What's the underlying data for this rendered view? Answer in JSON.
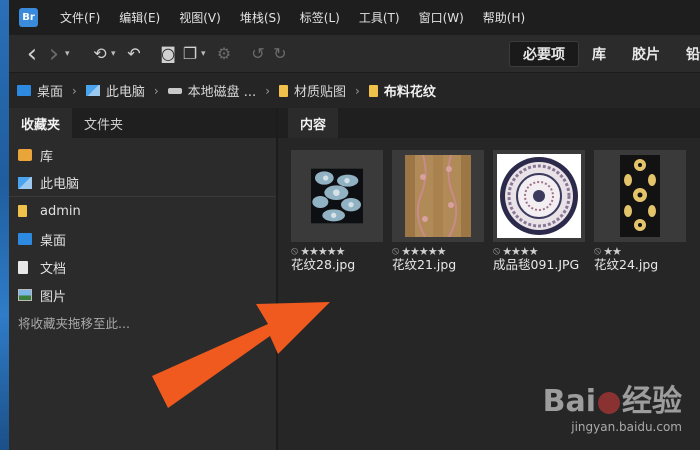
{
  "app": {
    "icon_text": "Br"
  },
  "menu": [
    {
      "label": "文件(F)"
    },
    {
      "label": "编辑(E)"
    },
    {
      "label": "视图(V)"
    },
    {
      "label": "堆栈(S)"
    },
    {
      "label": "标签(L)"
    },
    {
      "label": "工具(T)"
    },
    {
      "label": "窗口(W)"
    },
    {
      "label": "帮助(H)"
    }
  ],
  "toolbar": {
    "back_glyph": "‹",
    "forward_glyph": "›",
    "caret_glyph": "▾",
    "history_glyph": "⟲",
    "boomerang_glyph": "↶",
    "camera_glyph": "◙",
    "copy_glyph": "❐",
    "refine_glyph": "⚙",
    "rotate_left_glyph": "↺",
    "rotate_right_glyph": "↻",
    "workspaces": [
      {
        "label": "必要项",
        "active": true
      },
      {
        "label": "库"
      },
      {
        "label": "胶片"
      },
      {
        "label": "铅"
      }
    ]
  },
  "path": [
    {
      "label": "桌面",
      "icon": "desktop-icon"
    },
    {
      "label": "此电脑",
      "icon": "pc-icon"
    },
    {
      "label": "本地磁盘 ...",
      "icon": "disk-icon"
    },
    {
      "label": "材质贴图",
      "icon": "folder-icon"
    },
    {
      "label": "布料花纹",
      "icon": "folder-icon"
    }
  ],
  "path_separator": "›",
  "left_panel": {
    "tabs": [
      {
        "label": "收藏夹"
      },
      {
        "label": "文件夹"
      }
    ],
    "favorites": [
      {
        "label": "库"
      },
      {
        "label": "此电脑"
      },
      {
        "label": "admin"
      },
      {
        "label": "桌面"
      },
      {
        "label": "文档"
      },
      {
        "label": "图片"
      }
    ],
    "hint": "将收藏夹拖移至此..."
  },
  "right_panel": {
    "tabs": [
      {
        "label": "内容"
      }
    ],
    "items": [
      {
        "name": "花纹28.jpg",
        "rating_stars": 5,
        "rating_text": "★★★★★"
      },
      {
        "name": "花纹21.jpg",
        "rating_stars": 5,
        "rating_text": "★★★★★"
      },
      {
        "name": "成品毯091.JPG",
        "rating_stars": 4,
        "rating_text": "★★★★"
      },
      {
        "name": "花纹24.jpg",
        "rating_stars": 2,
        "rating_text": "★★"
      }
    ],
    "reject_glyph": "⦸"
  },
  "watermark": {
    "logo_pre": "Bai",
    "logo_post": "经验",
    "url": "jingyan.baidu.com"
  },
  "colors": {
    "arrow": "#f05a1e",
    "accent": "#3b8bdd"
  }
}
